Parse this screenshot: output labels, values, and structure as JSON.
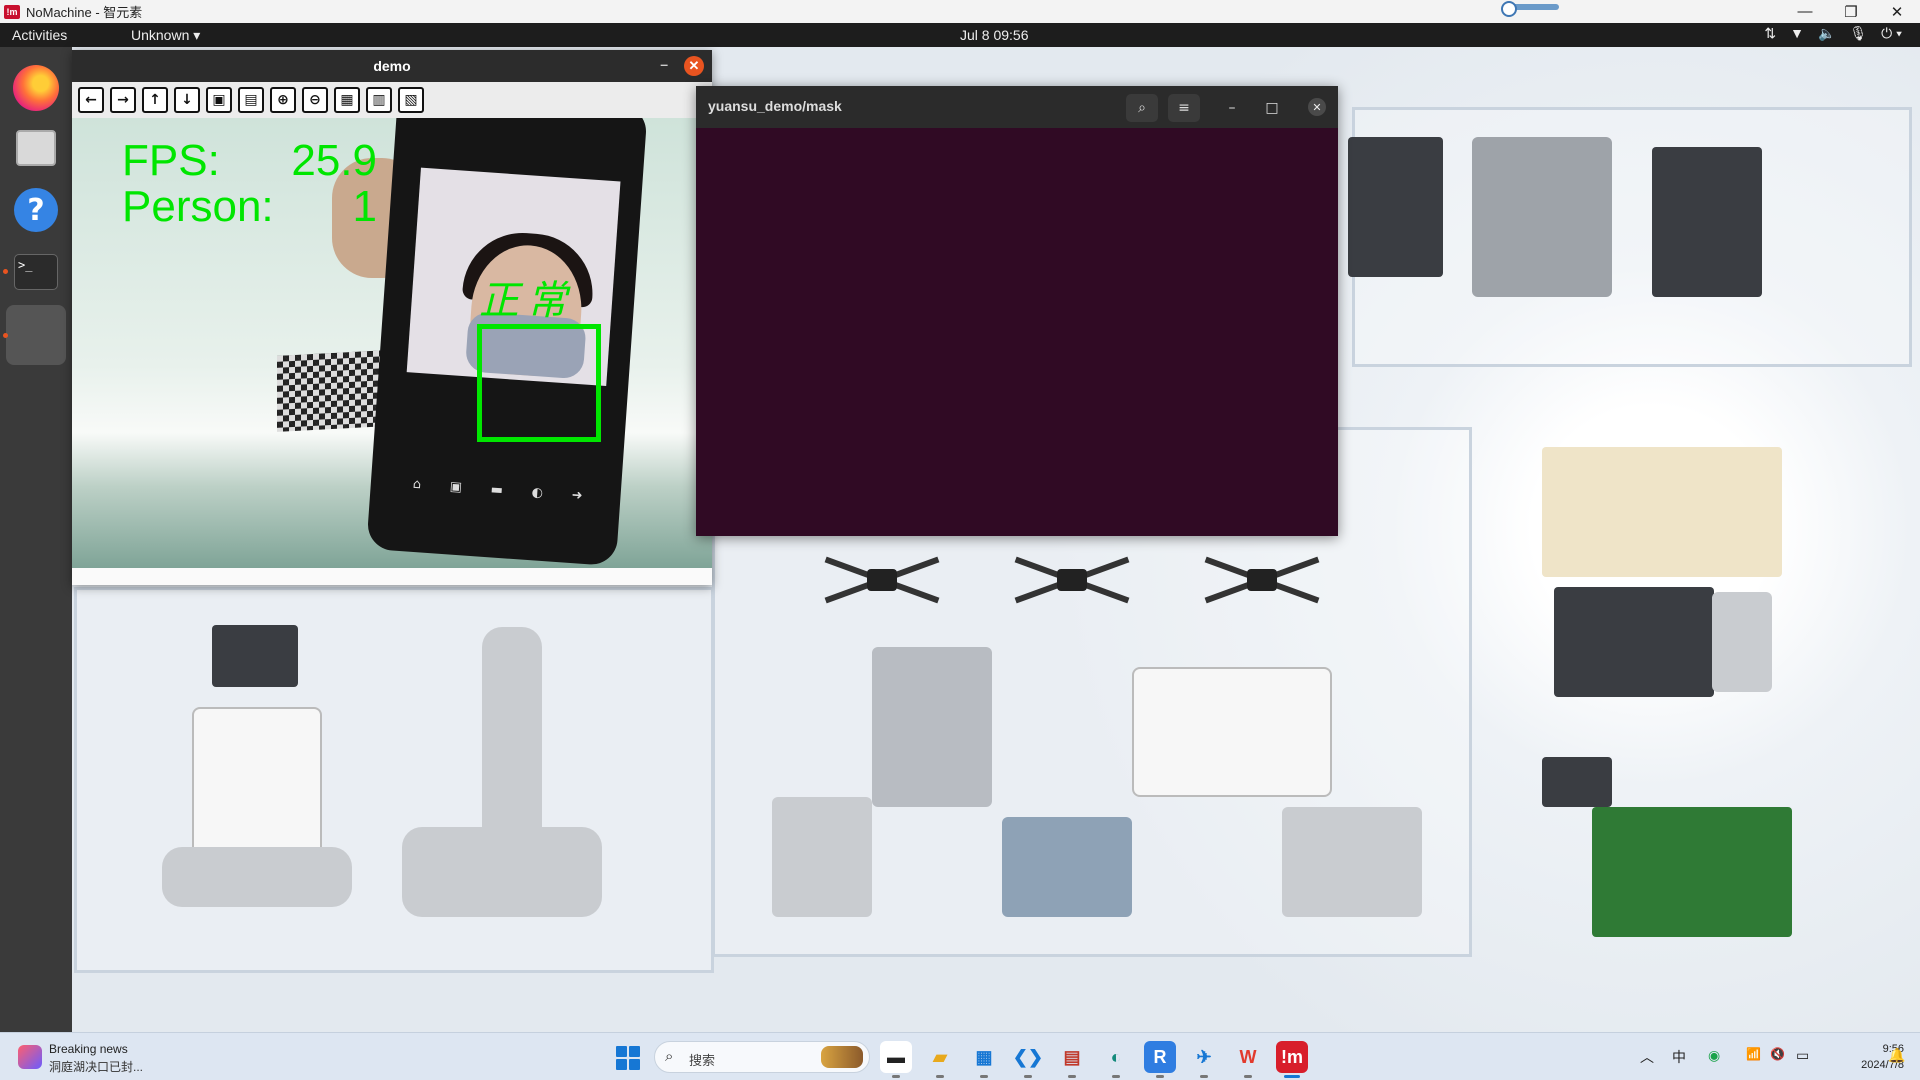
{
  "host_window": {
    "title": "NoMachine - 智元素",
    "logo_text": "!m",
    "controls": {
      "minimize": "—",
      "restore": "❐",
      "close": "✕"
    }
  },
  "ubuntu_topbar": {
    "activities": "Activities",
    "app_menu": "Unknown ▾",
    "clock": "Jul 8  09:56",
    "tray_icons": [
      "network-icon",
      "wifi-icon",
      "volume-icon",
      "mic-icon",
      "power-icon"
    ],
    "tray_glyphs": {
      "network": "⇅",
      "wifi": "▼",
      "volume": "🔈",
      "mic": "🎙",
      "power": "⏻ ▾"
    }
  },
  "dock": {
    "items": [
      "firefox",
      "files",
      "help",
      "terminal",
      "running-app"
    ],
    "help_glyph": "?",
    "terminal_glyph": ">_"
  },
  "demo_window": {
    "title": "demo",
    "minimize": "–",
    "close": "✕",
    "toolbar": [
      "←",
      "→",
      "↑",
      "↓",
      "▣",
      "▤",
      "⊕",
      "⊖",
      "▦",
      "▥",
      "▧"
    ],
    "hud": {
      "fps_label": "FPS:",
      "fps_value": "25.9",
      "person_label": "Person:",
      "person_value": "1"
    },
    "detection_label": "正常",
    "phone_nav": [
      "⌂",
      "▣",
      "▬",
      "◐",
      "➜"
    ]
  },
  "terminal_window": {
    "title": "yuansu_demo/mask",
    "search_glyph": "⌕",
    "menu_glyph": "≡",
    "minimize": "–",
    "maximize": "□",
    "close": "✕"
  },
  "taskbar": {
    "news_title": "Breaking news",
    "news_subtitle": "洞庭湖决口已封...",
    "search_placeholder": "搜索",
    "search_glyph": "⌕",
    "apps": [
      {
        "name": "task-view",
        "glyph": "▬",
        "color": "#222222",
        "bg": "#ffffff"
      },
      {
        "name": "file-explorer",
        "glyph": "▰",
        "color": "#e8a91c",
        "bg": "transparent"
      },
      {
        "name": "ms-store",
        "glyph": "▦",
        "color": "#1677d4",
        "bg": "transparent"
      },
      {
        "name": "vscode",
        "glyph": "❮❯",
        "color": "#1677d4",
        "bg": "transparent"
      },
      {
        "name": "calculator-app",
        "glyph": "▤",
        "color": "#c0392b",
        "bg": "transparent"
      },
      {
        "name": "edge",
        "glyph": "◐",
        "color": "#138a7b",
        "bg": "transparent"
      },
      {
        "name": "rdp-app",
        "glyph": "R",
        "color": "#ffffff",
        "bg": "#2f7de1"
      },
      {
        "name": "mail-app",
        "glyph": "✈",
        "color": "#1677d4",
        "bg": "transparent"
      },
      {
        "name": "wps",
        "glyph": "W",
        "color": "#e23a2d",
        "bg": "transparent"
      },
      {
        "name": "nomachine",
        "glyph": "!m",
        "color": "#ffffff",
        "bg": "#d81e2b"
      }
    ],
    "tray": {
      "chevron": "︿",
      "ime": "中",
      "app_tray": "◉",
      "wifi": "📶",
      "volume": "🔇",
      "battery": "▭",
      "time": "9:56",
      "date": "2024/7/8",
      "bell": "🔔"
    }
  },
  "colors": {
    "detection_green": "#00e600",
    "terminal_bg": "#300a24",
    "accent": "#e95420"
  }
}
